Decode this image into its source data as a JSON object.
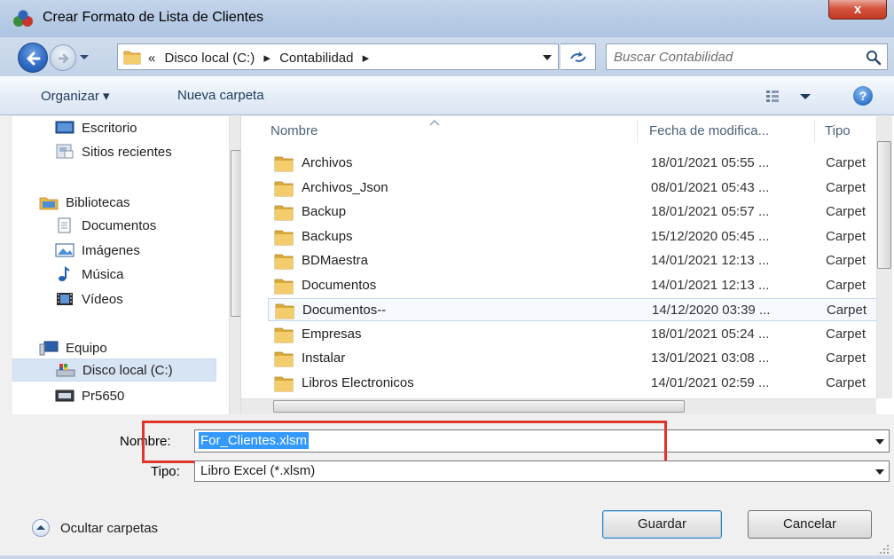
{
  "window": {
    "title": "Crear Formato de Lista de Clientes",
    "close_label": "x"
  },
  "address": {
    "crumbs": [
      "«",
      "Disco local (C:)",
      "▸",
      "Contabilidad",
      "▸"
    ],
    "search_placeholder": "Buscar Contabilidad"
  },
  "toolbar": {
    "organize_label": "Organizar ▾",
    "new_folder_label": "Nueva carpeta",
    "help_label": "?"
  },
  "nav": {
    "items": [
      {
        "label": "Escritorio",
        "icon": "desktop-icon"
      },
      {
        "label": "Sitios recientes",
        "icon": "recent-places-icon"
      },
      {
        "label": "Bibliotecas",
        "icon": "libraries-icon"
      },
      {
        "label": "Documentos",
        "icon": "documents-icon"
      },
      {
        "label": "Imágenes",
        "icon": "pictures-icon"
      },
      {
        "label": "Música",
        "icon": "music-icon"
      },
      {
        "label": "Vídeos",
        "icon": "videos-icon"
      },
      {
        "label": "Equipo",
        "icon": "computer-icon"
      },
      {
        "label": "Disco local (C:)",
        "icon": "local-disk-icon"
      },
      {
        "label": "Pr5650",
        "icon": "network-drive-icon"
      }
    ]
  },
  "files": {
    "columns": {
      "name": "Nombre",
      "date": "Fecha de modifica...",
      "type": "Tipo"
    },
    "rows": [
      {
        "name": "Archivos",
        "date": "18/01/2021 05:55 ...",
        "type": "Carpet"
      },
      {
        "name": "Archivos_Json",
        "date": "08/01/2021 05:43 ...",
        "type": "Carpet"
      },
      {
        "name": "Backup",
        "date": "18/01/2021 05:57 ...",
        "type": "Carpet"
      },
      {
        "name": "Backups",
        "date": "15/12/2020 05:45 ...",
        "type": "Carpet"
      },
      {
        "name": "BDMaestra",
        "date": "14/01/2021 12:13 ...",
        "type": "Carpet"
      },
      {
        "name": "Documentos",
        "date": "14/01/2021 12:13 ...",
        "type": "Carpet"
      },
      {
        "name": "Documentos--",
        "date": "14/12/2020 03:39 ...",
        "type": "Carpet"
      },
      {
        "name": "Empresas",
        "date": "18/01/2021 05:24 ...",
        "type": "Carpet"
      },
      {
        "name": "Instalar",
        "date": "13/01/2021 03:08 ...",
        "type": "Carpet"
      },
      {
        "name": "Libros Electronicos",
        "date": "14/01/2021 02:59 ...",
        "type": "Carpet"
      }
    ]
  },
  "form": {
    "name_label": "Nombre:",
    "name_value": "For_Clientes.xlsm",
    "type_label": "Tipo:",
    "type_value": "Libro Excel (*.xlsm)",
    "save_label": "Guardar",
    "cancel_label": "Cancelar",
    "hide_folders_label": "Ocultar carpetas"
  },
  "colors": {
    "highlight_box": "#e0352b",
    "selection": "#3399ff",
    "folder": "#e8b84a"
  }
}
